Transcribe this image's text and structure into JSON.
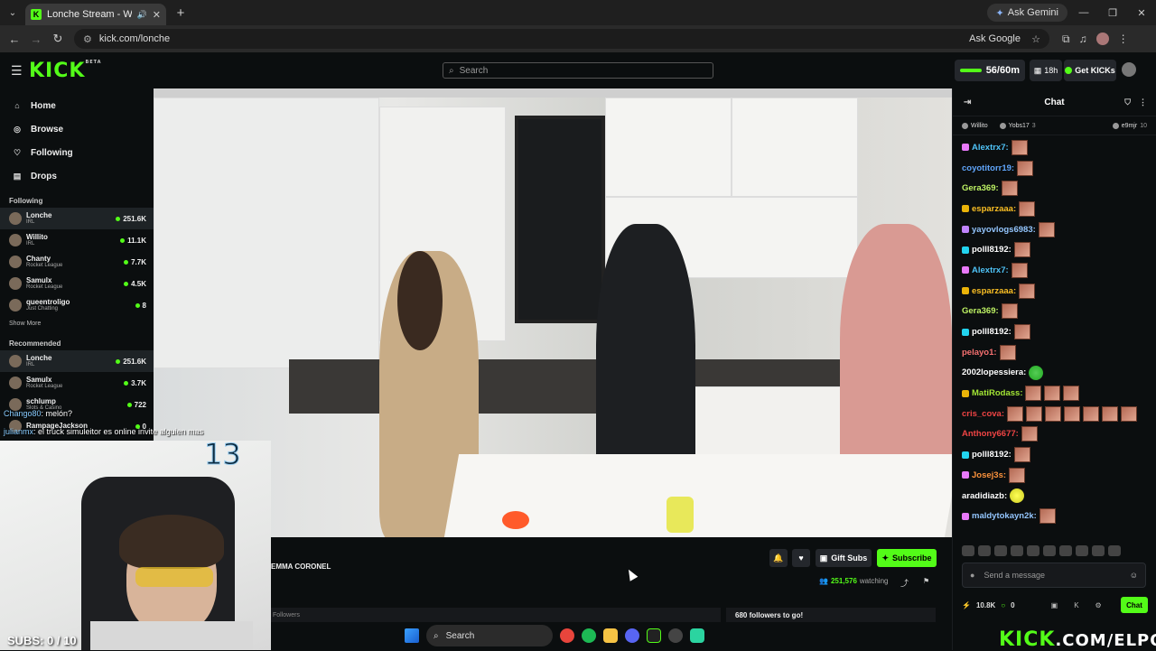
{
  "browser": {
    "tab_title": "Lonche Stream - Watch Live",
    "tab_favicon": "K",
    "ask_gemini": "Ask Gemini",
    "url": "kick.com/lonche",
    "ask_google": "Ask Google"
  },
  "header": {
    "logo": "KICK",
    "logo_tag": "BETA",
    "search_placeholder": "Search",
    "kicks_progress": "56/60m",
    "streak": "18h",
    "get_kicks": "Get KICKs"
  },
  "sidebar": {
    "nav": [
      {
        "label": "Home",
        "icon": "home-icon"
      },
      {
        "label": "Browse",
        "icon": "compass-icon"
      },
      {
        "label": "Following",
        "icon": "heart-icon"
      },
      {
        "label": "Drops",
        "icon": "gift-icon"
      }
    ],
    "following_title": "Following",
    "following": [
      {
        "name": "Lonche",
        "category": "IRL",
        "viewers": "251.6K"
      },
      {
        "name": "Willito",
        "category": "IRL",
        "viewers": "11.1K"
      },
      {
        "name": "Chanty",
        "category": "Rocket League",
        "viewers": "7.7K"
      },
      {
        "name": "Samulx",
        "category": "Rocket League",
        "viewers": "4.5K"
      },
      {
        "name": "queentroligo",
        "category": "Just Chatting",
        "viewers": "8"
      }
    ],
    "show_more": "Show More",
    "recommended_title": "Recommended",
    "recommended": [
      {
        "name": "Lonche",
        "category": "IRL",
        "viewers": "251.6K"
      },
      {
        "name": "Samulx",
        "category": "Rocket League",
        "viewers": "3.7K"
      },
      {
        "name": "schlump",
        "category": "Slots & Casino",
        "viewers": "722"
      },
      {
        "name": "RampageJackson",
        "category": "",
        "viewers": "0"
      }
    ]
  },
  "overlay": {
    "line1_user": "Chango80",
    "line1_text": ": melón?",
    "line2_user": "julianmx",
    "line2_text": ": el truck simuleitor es online invite alguien mas",
    "big_number": "13",
    "subs": "SUBS: 0 / 10"
  },
  "stream": {
    "streamer_name": "EMMA CORONEL",
    "gift_subs": "Gift Subs",
    "subscribe": "Subscribe",
    "viewers": "251,576",
    "watching_label": "watching",
    "tab_label": "Followers",
    "goal_text": "680 followers to go!"
  },
  "chat": {
    "title": "Chat",
    "gifters": [
      {
        "name": "Willito",
        "count": ""
      },
      {
        "name": "Yobs17",
        "count": "3"
      },
      {
        "name": "e9mjr",
        "count": "10"
      }
    ],
    "messages": [
      {
        "user": "Alextrx7:",
        "color": "#4fc3f7",
        "emotes": 1,
        "badge": "#e879f9"
      },
      {
        "user": "coyotitorr19:",
        "color": "#60a5fa",
        "emotes": 1,
        "badge": ""
      },
      {
        "user": "Gera369:",
        "color": "#bef264",
        "emotes": 1,
        "badge": ""
      },
      {
        "user": "esparzaaa:",
        "color": "#fbbf24",
        "emotes": 1,
        "badge": "#eab308"
      },
      {
        "user": "yayovlogs6983:",
        "color": "#93c5fd",
        "emotes": 1,
        "badge": "#c084fc"
      },
      {
        "user": "polll8192:",
        "color": "#ffffff",
        "emotes": 1,
        "badge": "#22d3ee"
      },
      {
        "user": "Alextrx7:",
        "color": "#4fc3f7",
        "emotes": 1,
        "badge": "#e879f9"
      },
      {
        "user": "esparzaaa:",
        "color": "#fbbf24",
        "emotes": 1,
        "badge": "#eab308"
      },
      {
        "user": "Gera369:",
        "color": "#bef264",
        "emotes": 1,
        "badge": ""
      },
      {
        "user": "polll8192:",
        "color": "#ffffff",
        "emotes": 1,
        "badge": "#22d3ee"
      },
      {
        "user": "pelayo1:",
        "color": "#f87171",
        "emotes": 1,
        "badge": ""
      },
      {
        "user": "2002lopessiera:",
        "color": "#ffffff",
        "emotes": 1,
        "badge": ""
      },
      {
        "user": "MatiRodass:",
        "color": "#a3e635",
        "emotes": 3,
        "badge": "#eab308"
      },
      {
        "user": "cris_cova:",
        "color": "#ef4444",
        "emotes": 7,
        "badge": ""
      },
      {
        "user": "Anthony6677:",
        "color": "#ef4444",
        "emotes": 1,
        "badge": ""
      },
      {
        "user": "polll8192:",
        "color": "#ffffff",
        "emotes": 1,
        "badge": "#22d3ee"
      },
      {
        "user": "Josej3s:",
        "color": "#fb923c",
        "emotes": 1,
        "badge": "#e879f9"
      },
      {
        "user": "aradidiazb:",
        "color": "#ffffff",
        "emotes": 1,
        "badge": ""
      },
      {
        "user": "maldytokayn2k:",
        "color": "#93c5fd",
        "emotes": 1,
        "badge": "#e879f9"
      }
    ],
    "input_placeholder": "Send a message",
    "kicks_count": "10.8K",
    "points": "0",
    "chat_button": "Chat"
  },
  "taskbar": {
    "search": "Search"
  },
  "watermark": {
    "brand": "KICK",
    "path": ".COM/ELPOLIN"
  }
}
